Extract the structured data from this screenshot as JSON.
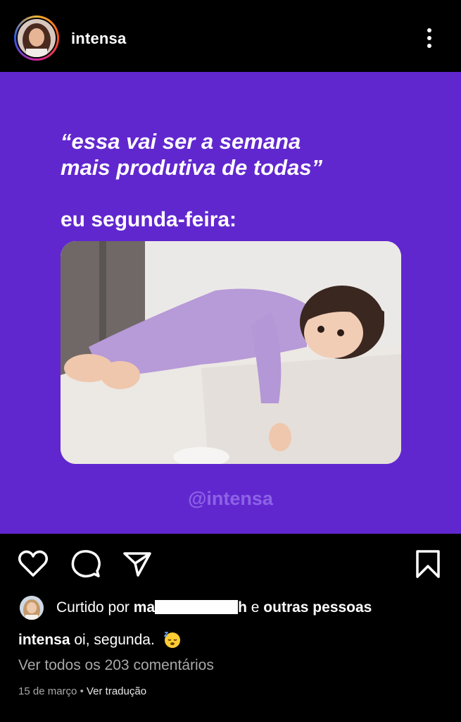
{
  "header": {
    "username": "intensa"
  },
  "post": {
    "quote_line1": "“essa vai ser a semana",
    "quote_line2": "mais produtiva de todas”",
    "subtitle": "eu segunda-feira:",
    "watermark": "@intensa",
    "background_color": "#6127cf"
  },
  "actions": {
    "like": "heart-icon",
    "comment": "comment-icon",
    "share": "send-icon",
    "save": "bookmark-icon"
  },
  "likes": {
    "prefix": "Curtido por",
    "name_start": "ma",
    "name_end": "h",
    "connector": "e",
    "others": "outras pessoas"
  },
  "caption": {
    "username": "intensa",
    "text": "oi, segunda."
  },
  "comments_link": "Ver todos os 203 comentários",
  "meta": {
    "date": "15 de março",
    "separator": "•",
    "translate": "Ver tradução"
  }
}
